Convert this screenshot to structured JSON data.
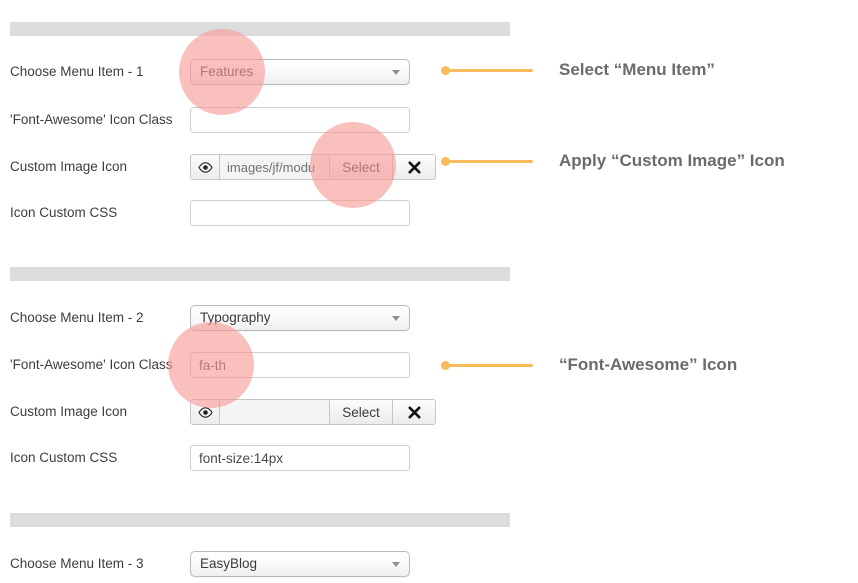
{
  "sections": [
    {
      "id": "menu-item-1",
      "rows": [
        {
          "type": "select",
          "label": "Choose Menu Item - 1",
          "value": "Features"
        },
        {
          "type": "text",
          "label": "'Font-Awesome' Icon Class",
          "value": "",
          "placeholder": ""
        },
        {
          "type": "media",
          "label": "Custom Image Icon",
          "path": "images/jf/modu",
          "select_label": "Select",
          "clear_label": "✖",
          "eye_icon": "eye-icon"
        },
        {
          "type": "text",
          "label": "Icon Custom CSS",
          "value": "",
          "placeholder": ""
        }
      ]
    },
    {
      "id": "menu-item-2",
      "rows": [
        {
          "type": "select",
          "label": "Choose Menu Item - 2",
          "value": "Typography"
        },
        {
          "type": "text",
          "label": "'Font-Awesome' Icon Class",
          "value": "fa-th",
          "placeholder": ""
        },
        {
          "type": "media",
          "label": "Custom Image Icon",
          "path": "",
          "select_label": "Select",
          "clear_label": "✖",
          "eye_icon": "eye-icon"
        },
        {
          "type": "text",
          "label": "Icon Custom CSS",
          "value": "font-size:14px",
          "placeholder": ""
        }
      ]
    },
    {
      "id": "menu-item-3",
      "rows": [
        {
          "type": "select",
          "label": "Choose Menu Item - 3",
          "value": "EasyBlog"
        }
      ]
    }
  ],
  "annotations": [
    {
      "id": "annot-select-menu-item",
      "text": "Select “Menu Item”"
    },
    {
      "id": "annot-apply-custom-image-icon",
      "text": "Apply “Custom Image” Icon"
    },
    {
      "id": "annot-font-awesome-icon",
      "text": "“Font-Awesome” Icon"
    }
  ],
  "colors": {
    "highlight": "#f59a96",
    "annotation_accent": "#f8bc5c",
    "annotation_text": "#6b6b6b",
    "section_bar": "#dcdcdc",
    "label_text": "#3d3d3d",
    "background": "#ffffff"
  },
  "icons": {
    "eye": "◉",
    "clear": "✖",
    "dropdown_arrow": "caret-down-icon"
  }
}
